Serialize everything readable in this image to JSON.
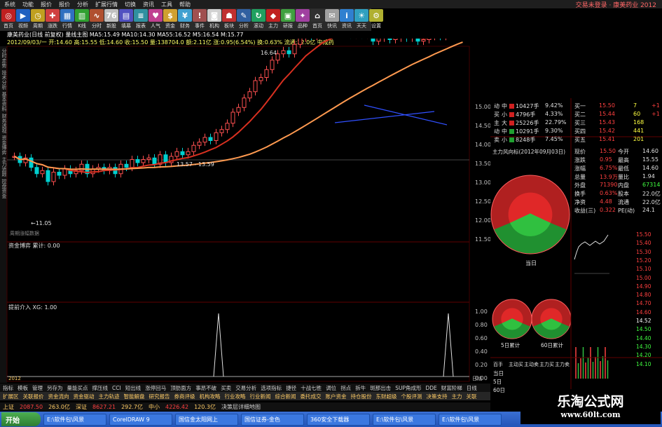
{
  "menu": {
    "items": [
      "系统",
      "功能",
      "报价",
      "报价",
      "分析",
      "扩展行情",
      "切换",
      "资讯",
      "工具",
      "帮助"
    ],
    "right_title": "交易未登录 · 康美药业 2012"
  },
  "toolbar": [
    {
      "label": "首页",
      "color": "#c02020",
      "glyph": "◎"
    },
    {
      "label": "视频",
      "color": "#2060c0",
      "glyph": "▶"
    },
    {
      "label": "周期",
      "color": "#c0a020",
      "glyph": "◷"
    },
    {
      "label": "涨跌",
      "color": "#d04040",
      "glyph": "✚"
    },
    {
      "label": "行情",
      "color": "#3070c0",
      "glyph": "▦"
    },
    {
      "label": "K线",
      "color": "#30a030",
      "glyph": "▥"
    },
    {
      "label": "分时",
      "color": "#b05030",
      "glyph": "∿"
    },
    {
      "label": "新股",
      "color": "#c0c0c0",
      "glyph": "76"
    },
    {
      "label": "填幕",
      "color": "#5050c0",
      "glyph": "▤"
    },
    {
      "label": "报表",
      "color": "#3090a0",
      "glyph": "≡"
    },
    {
      "label": "人气",
      "color": "#c04090",
      "glyph": "♥"
    },
    {
      "label": "资金",
      "color": "#d0a030",
      "glyph": "$"
    },
    {
      "label": "财务",
      "color": "#40a0d0",
      "glyph": "¥"
    },
    {
      "label": "事件",
      "color": "#a05050",
      "glyph": "!"
    },
    {
      "label": "机构",
      "color": "#d0d0d0",
      "glyph": "◙"
    },
    {
      "label": "板块",
      "color": "#c03030",
      "glyph": "☗"
    },
    {
      "label": "分析",
      "color": "#3060a0",
      "glyph": "✎"
    },
    {
      "label": "滚动",
      "color": "#20a060",
      "glyph": "↻"
    },
    {
      "label": "主力",
      "color": "#c02020",
      "glyph": "◆"
    },
    {
      "label": "研报",
      "color": "#40a040",
      "glyph": "▣"
    },
    {
      "label": "品种",
      "color": "#a040a0",
      "glyph": "✦"
    },
    {
      "label": "首页",
      "color": "#303030",
      "glyph": "⌂"
    },
    {
      "label": "快讯",
      "color": "#a0a0a0",
      "glyph": "✉"
    },
    {
      "label": "资讯",
      "color": "#3080d0",
      "glyph": "i"
    },
    {
      "label": "天天",
      "color": "#30a0c0",
      "glyph": "☀"
    },
    {
      "label": "设置",
      "color": "#b0b030",
      "glyph": "⚙"
    }
  ],
  "infobar1": "康美药业(日线 前复权)   量线主图   MA5:15.49   MA10:14.30   MA55:16.52   M5:16.54   M:15.77",
  "infobar2": "2012/09/03/一  开:14.60  高:15.55  低:14.60  收:15.50  量:138704.0  额:2.11亿  涨:0.95(6.54%)  换:0.63%  流通:22.0亿  中成药",
  "left_tabs": [
    "分时走势",
    "技术分析",
    "基本资料",
    "财务透视",
    "资金博弈",
    "主力追踪",
    "控盘资金"
  ],
  "chart": {
    "price_labels": [
      "15.00",
      "14.50",
      "14.00",
      "13.50",
      "13.00",
      "12.50",
      "12.00",
      "11.50"
    ],
    "max_label": "16.64",
    "min_label": "11.05",
    "range_label": "13.57 - 13.59",
    "footer_note": "周期涨幅数据",
    "panel2_title": "资金博弈  累计: 0.00",
    "panel3_title": "提前介入 XG: 1.00",
    "panel3_ticks": [
      "1.00",
      "0.80",
      "0.60",
      "0.40",
      "0.20",
      "0.00"
    ],
    "date_start": "2012",
    "date_end": "日线"
  },
  "flow_table": [
    {
      "label": "中",
      "vol": "10427手",
      "pct": "9.42%"
    },
    {
      "label": "小",
      "vol": "4796手",
      "pct": "4.33%"
    },
    {
      "label": "大",
      "vol": "25226手",
      "pct": "22.79%"
    },
    {
      "label": "中",
      "vol": "10291手",
      "pct": "9.30%"
    },
    {
      "label": "小",
      "vol": "8248手",
      "pct": "7.45%"
    }
  ],
  "flow_side": [
    "动",
    "买",
    "主",
    "动",
    "卖"
  ],
  "orderbook": {
    "buy": [
      {
        "label": "买一",
        "price": "15.50",
        "vol": "7",
        "chg": "+1"
      },
      {
        "label": "买二",
        "price": "15.44",
        "vol": "60",
        "chg": "+1"
      },
      {
        "label": "买三",
        "price": "15.43",
        "vol": "168",
        "chg": ""
      },
      {
        "label": "买四",
        "price": "15.42",
        "vol": "441",
        "chg": ""
      },
      {
        "label": "买五",
        "price": "15.41",
        "vol": "201",
        "chg": ""
      }
    ]
  },
  "quote": [
    {
      "k1": "现价",
      "v1": "15.50",
      "k2": "今开",
      "v2": "14.60"
    },
    {
      "k1": "涨跌",
      "v1": "0.95",
      "k2": "最高",
      "v2": "15.55"
    },
    {
      "k1": "涨幅",
      "v1": "6.75%",
      "k2": "最低",
      "v2": "14.60"
    },
    {
      "k1": "总量",
      "v1": "13.9万",
      "k2": "量比",
      "v2": "1.94"
    },
    {
      "k1": "外盘",
      "v1": "71390",
      "k2": "内盘",
      "v2": "67314"
    },
    {
      "k1": "换手",
      "v1": "0.63%",
      "k2": "股本",
      "v2": "22.0亿"
    },
    {
      "k1": "净资",
      "v1": "4.48",
      "k2": "流通",
      "v2": "22.0亿"
    },
    {
      "k1": "收益(三)",
      "v1": "0.322",
      "k2": "PE(动)",
      "v2": "24.1"
    }
  ],
  "main_force_title": "主力风向标(2012年09月03日)",
  "donut_labels": {
    "today": "当日",
    "day5": "5日累计",
    "day60": "60日累计"
  },
  "mini_prices": [
    "15.50",
    "15.40",
    "15.30",
    "15.20",
    "15.10",
    "15.00",
    "14.90",
    "14.80",
    "14.70",
    "14.60",
    "14.52",
    "14.50",
    "14.40",
    "14.30",
    "14.20",
    "14.10"
  ],
  "bottom_table": {
    "header": [
      "百手",
      "主动买",
      "主动卖",
      "主力买",
      "主力卖"
    ],
    "rows": [
      {
        "label": "当日",
        "vals": [
          "",
          "",
          "",
          ""
        ]
      },
      {
        "label": "5日",
        "vals": [
          "",
          "",
          "",
          ""
        ]
      },
      {
        "label": "60日",
        "vals": [
          "",
          "",
          "",
          ""
        ]
      }
    ]
  },
  "tabstrip1": [
    "指标",
    "模板",
    "管理",
    "另存为",
    "量能买点",
    "撑压线",
    "CCI",
    "短出线",
    "涨停回马",
    "顶肪面方",
    "事昂不破",
    "买卖",
    "交易分析",
    "选项指标",
    "捷径",
    "十战七胜",
    "调位",
    "拐点",
    "拆牛",
    "斑那出击",
    "SUP角成形",
    "DDE",
    "财富阶梯",
    "日线"
  ],
  "tabstrip2": [
    "扩展区",
    "关联报价",
    "资金流向",
    "资金驱动",
    "主力轨迹",
    "智能解盘",
    "研究报告",
    "券商评级",
    "机构攻略",
    "行业攻略",
    "行业新闻",
    "综合新闻",
    "委托成交",
    "账户资金",
    "持仓股份",
    "东财超级",
    "个股评测",
    "决策支持",
    "主力",
    "关联"
  ],
  "statusbar": [
    {
      "t": "上证",
      "c": "#ffcc66"
    },
    {
      "t": "2087.50",
      "c": "#ff4040"
    },
    {
      "t": "263.0亿",
      "c": "#ffcc66"
    },
    {
      "t": "深证",
      "c": "#ffcc66"
    },
    {
      "t": "8627.21",
      "c": "#ff4040"
    },
    {
      "t": "292.7亿",
      "c": "#ffcc66"
    },
    {
      "t": "中小",
      "c": "#ffcc66"
    },
    {
      "t": "4226.42",
      "c": "#ff4040"
    },
    {
      "t": "120.3亿",
      "c": "#ffcc66"
    },
    {
      "t": "决策层详细地图",
      "c": "#d0d0d0"
    }
  ],
  "taskbar": {
    "start": "开始",
    "tasks": [
      "E:\\软件包\\风景",
      "CorelDRAW 9",
      "国信金太阳网上",
      "国信证券-金色",
      "360安全下载器",
      "E:\\软件包\\风景",
      "E:\\软件包\\风景"
    ]
  },
  "watermark": {
    "title": "乐淘公式网",
    "url": "www.60lt.com"
  },
  "colors": {
    "up": "#ff3030",
    "down": "#00d0d0",
    "ma_red": "#d83020",
    "ma_orange": "#ff9a50",
    "green": "#30c040"
  }
}
